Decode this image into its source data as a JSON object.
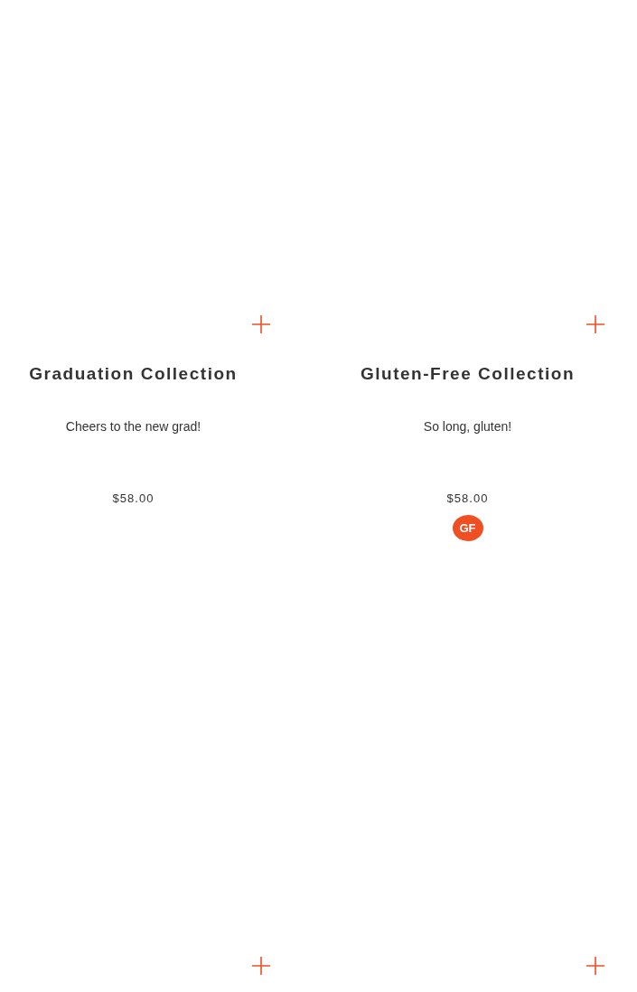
{
  "products": [
    {
      "kind": "collection",
      "title": "Graduation Collection",
      "description": "Cheers to the new grad!",
      "price": "$58.00"
    },
    {
      "kind": "collection",
      "title": "Gluten-Free Collection",
      "description": "So long, gluten!",
      "price": "$58.00",
      "badges": [
        "GF"
      ]
    },
    {
      "kind": "image_only"
    },
    {
      "kind": "image_only"
    }
  ]
}
